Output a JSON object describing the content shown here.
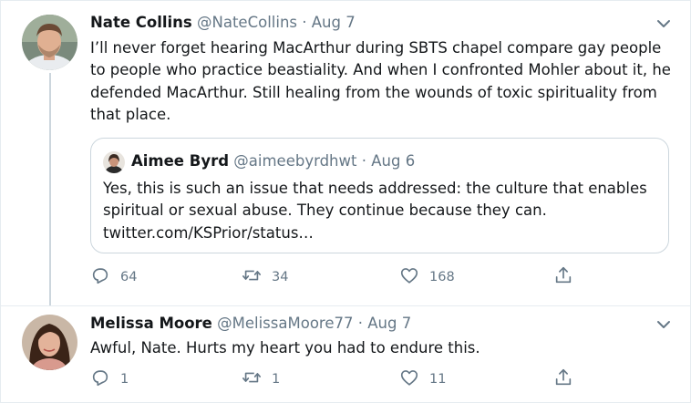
{
  "tweets": [
    {
      "name": "Nate Collins",
      "handle": "@NateCollins",
      "separator": "·",
      "date": "Aug 7",
      "text": "I’ll never forget hearing MacArthur during SBTS chapel compare gay people to people who practice beastiality. And when I confronted Mohler about it, he defended MacArthur. Still healing from the wounds of toxic spirituality from that place.",
      "quoted": {
        "name": "Aimee Byrd",
        "handle": "@aimeebyrdhwt",
        "separator": "·",
        "date": "Aug 6",
        "text": "Yes, this is such an issue that needs addressed: the culture that enables spiritual or sexual abuse. They continue because they can. twitter.com/KSPrior/status…"
      },
      "stats": {
        "replies": "64",
        "retweets": "34",
        "likes": "168"
      }
    },
    {
      "name": "Melissa Moore",
      "handle": "@MelissaMoore77",
      "separator": "·",
      "date": "Aug 7",
      "text": "Awful, Nate. Hurts my heart you had to endure this.",
      "stats": {
        "replies": "1",
        "retweets": "1",
        "likes": "11"
      }
    }
  ],
  "icons": {
    "reply": "reply-icon",
    "retweet": "retweet-icon",
    "like": "heart-icon",
    "share": "share-icon",
    "more": "chevron-down-icon"
  },
  "colors": {
    "text": "#14171a",
    "secondary": "#657786",
    "border": "#e6ecf0",
    "thread_line": "#ccd6dd"
  }
}
